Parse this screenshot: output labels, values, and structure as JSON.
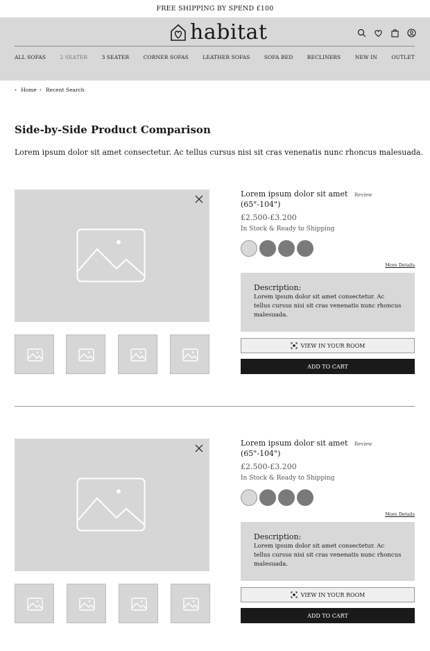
{
  "promo": {
    "text": "FREE SHIPPING BY SPEND  £100"
  },
  "header": {
    "logo_text": "habitat",
    "icons": [
      "search-icon",
      "heart-icon",
      "bag-icon",
      "user-icon"
    ]
  },
  "nav": {
    "items": [
      {
        "label": "ALL SOFAS"
      },
      {
        "label": "2 SEATER"
      },
      {
        "label": "3 SEATER"
      },
      {
        "label": "CORNER SOFAS"
      },
      {
        "label": "LEATHER SOFAS"
      },
      {
        "label": "SOFA BED"
      },
      {
        "label": "RECLINERS"
      },
      {
        "label": "NEW IN"
      },
      {
        "label": "OUTLET"
      }
    ],
    "active": "2 SEATER"
  },
  "breadcrumb": {
    "home": "Home",
    "current": "Recent Search"
  },
  "page": {
    "title": "Side-by-Side Product Comparison",
    "description": "Lorem ipsum dolor sit amet consectetur. Ac tellus cursus nisi sit cras venenatis nunc rhoncus malesuada."
  },
  "products": [
    {
      "name_line1": "Lorem ipsum dolor sit amet",
      "review": "Review",
      "name_line2": "(65\"-104\")",
      "price": "£2.500-£3.200",
      "stock": "In Stock & Ready to Shipping",
      "more_details": "More Details",
      "desc_label": "Description:",
      "desc_text": "Lorem ipsum dolor sit amet consectetur. Ac tellus cursus nisi sit cras venenatis nunc rhoncus malesuada.",
      "view_room": "VIEW IN YOUR ROOM",
      "add_to_cart": "ADD TO CART"
    },
    {
      "name_line1": "Lorem ipsum dolor sit amet",
      "review": "Review",
      "name_line2": "(65\"-104\")",
      "price": "£2.500-£3.200",
      "stock": "In Stock & Ready to Shipping",
      "more_details": "More Details",
      "desc_label": "Description:",
      "desc_text": "Lorem ipsum dolor sit amet consectetur. Ac tellus cursus nisi sit cras venenatis nunc rhoncus malesuada.",
      "view_room": "VIEW IN YOUR ROOM",
      "add_to_cart": "ADD TO CART"
    }
  ],
  "colors": {
    "header_bg": "#d8d8d8",
    "placeholder_bg": "#d6d6d6",
    "swatch_dark": "#7a7a7a",
    "swatch_light": "#d8d8d8",
    "cart_button": "#1a1a1a"
  }
}
